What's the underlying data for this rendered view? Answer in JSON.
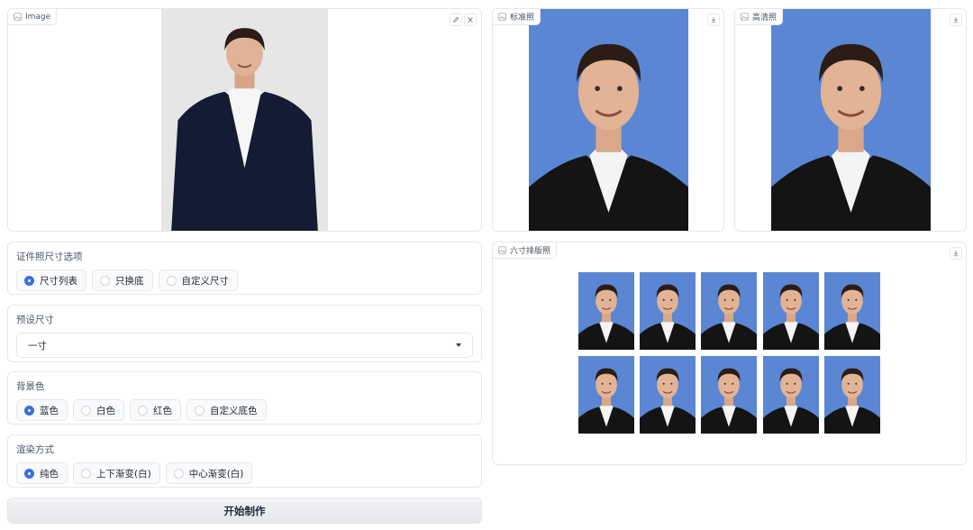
{
  "image_panel": {
    "label": "Image",
    "edit_icon": "pencil-icon",
    "close_icon": "close-icon"
  },
  "standard_panel": {
    "label": "标准照",
    "download_icon": "download-icon"
  },
  "hd_panel": {
    "label": "高清照",
    "download_icon": "download-icon"
  },
  "layout_panel": {
    "label": "六寸排版照",
    "download_icon": "download-icon",
    "copies": 10
  },
  "size_options": {
    "label": "证件照尺寸选项",
    "options": [
      "尺寸列表",
      "只换底",
      "自定义尺寸"
    ],
    "selected": "尺寸列表"
  },
  "preset_size": {
    "label": "预设尺寸",
    "value": "一寸"
  },
  "background_color": {
    "label": "背景色",
    "options": [
      "蓝色",
      "白色",
      "红色",
      "自定义底色"
    ],
    "selected": "蓝色"
  },
  "render_mode": {
    "label": "渲染方式",
    "options": [
      "纯色",
      "上下渐变(白)",
      "中心渐变(白)"
    ],
    "selected": "纯色"
  },
  "submit_button": {
    "label": "开始制作"
  },
  "colors": {
    "accent": "#3b6fe0",
    "photo_bg_blue": "#5b86d4"
  }
}
